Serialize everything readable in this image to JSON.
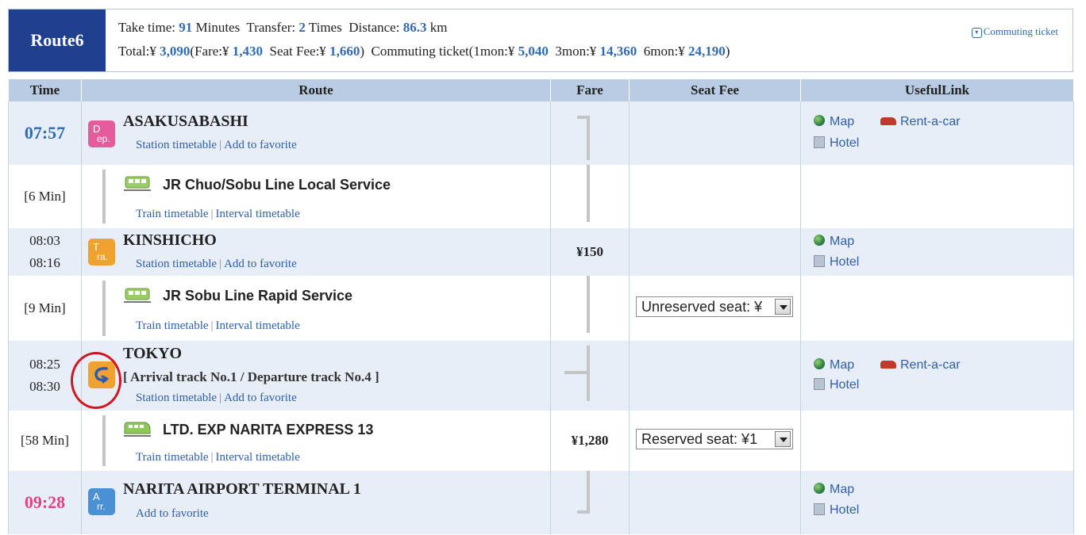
{
  "route": {
    "label": "Route6",
    "take_time_label": "Take time:",
    "take_time_value": "91",
    "take_time_unit": "Minutes",
    "transfer_label": "Transfer:",
    "transfer_value": "2",
    "transfer_unit": "Times",
    "distance_label": "Distance:",
    "distance_value": "86.3",
    "distance_unit": "km",
    "total_label": "Total:¥",
    "total_value": "3,090",
    "fare_label": "(Fare:¥",
    "fare_value": "1,430",
    "seat_label": "Seat Fee:¥",
    "seat_value": "1,660",
    "seat_close": ")",
    "commute_label": "Commuting ticket(1mon:¥",
    "m1_value": "5,040",
    "m3_label": "3mon:¥",
    "m3_value": "14,360",
    "m6_label": "6mon:¥",
    "m6_value": "24,190",
    "commute_close": ")",
    "commute_link": "Commuting ticket",
    "commute_link_icon": "▾"
  },
  "columns": [
    "Time",
    "Route",
    "Fare",
    "Seat Fee",
    "UsefulLink"
  ],
  "rows": {
    "asakusabashi": {
      "time": "07:57",
      "icon_top": "D",
      "icon_bottom": "ep.",
      "name": "ASAKUSABASHI",
      "link1": "Station timetable",
      "link2": "Add to favorite",
      "map": "Map",
      "rent": "Rent-a-car",
      "hotel": "Hotel"
    },
    "line1": {
      "duration": "[6 Min]",
      "name": "JR Chuo/Sobu Line Local Service",
      "link1": "Train timetable",
      "link2": "Interval timetable"
    },
    "kinshicho": {
      "time1": "08:03",
      "time2": "08:16",
      "icon_top": "T",
      "icon_bottom": "ra.",
      "name": "KINSHICHO",
      "link1": "Station timetable",
      "link2": "Add to favorite",
      "fare": "¥150",
      "map": "Map",
      "hotel": "Hotel"
    },
    "line2": {
      "duration": "[9 Min]",
      "name": "JR Sobu Line Rapid Service",
      "link1": "Train timetable",
      "link2": "Interval timetable",
      "seat_select": "Unreserved seat: ¥"
    },
    "tokyo": {
      "time1": "08:25",
      "time2": "08:30",
      "name": "TOKYO",
      "track": "[ Arrival track No.1 / Departure track No.4 ]",
      "link1": "Station timetable",
      "link2": "Add to favorite",
      "map": "Map",
      "rent": "Rent-a-car",
      "hotel": "Hotel"
    },
    "line3": {
      "duration": "[58 Min]",
      "name": "LTD. EXP NARITA EXPRESS 13",
      "link1": "Train timetable",
      "link2": "Interval timetable",
      "fare": "¥1,280",
      "seat_select": "Reserved seat: ¥1"
    },
    "narita": {
      "time": "09:28",
      "icon_top": "A",
      "icon_bottom": "rr.",
      "name": "NARITA AIRPORT TERMINAL 1",
      "link1": "Add to favorite",
      "map": "Map",
      "hotel": "Hotel"
    }
  },
  "separator": "|",
  "colors": {
    "header_bg": "#1f3f8f",
    "accent_blue": "#2f6bb3",
    "arrival_pink": "#e0457f",
    "dep_icon": "#e55c9c",
    "transfer_icon": "#f0a231",
    "arr_icon": "#4b8fd5",
    "highlight_circle": "#d0161e"
  }
}
